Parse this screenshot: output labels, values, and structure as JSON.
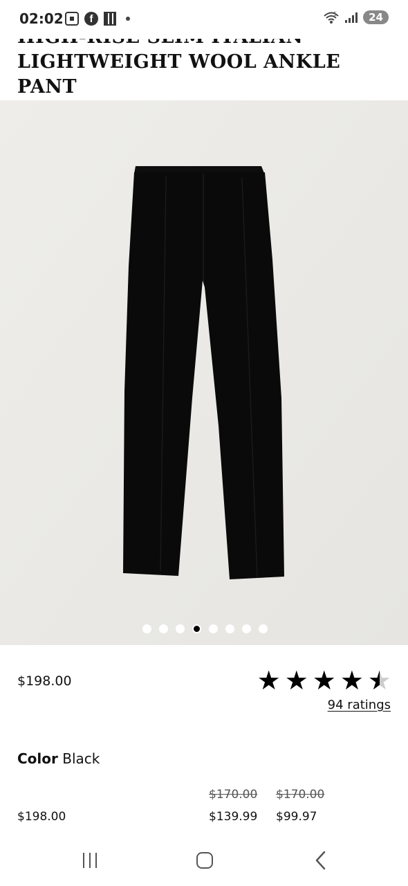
{
  "status_bar": {
    "time": "02:02",
    "battery": "24",
    "network": "5"
  },
  "product": {
    "title": "High-Rise Slim Italian Lightweight Wool Ankle Pant",
    "price": "$198.00",
    "rating": {
      "value": 4.5,
      "max": 5,
      "ratings_label": "94 ratings"
    },
    "color": {
      "label": "Color",
      "value": "Black"
    },
    "image": {
      "slide_count": 8,
      "active_slide": 4,
      "background": "#ebeae6"
    },
    "price_options": [
      {
        "original": "",
        "current": "$198.00"
      },
      {
        "original": "$170.00",
        "current": "$139.99"
      },
      {
        "original": "$170.00",
        "current": "$99.97"
      }
    ]
  },
  "icons": {
    "status_left": [
      "screenshot-icon",
      "facebook-icon",
      "qr-icon",
      "dot-icon"
    ],
    "status_right": [
      "wifi-icon",
      "signal-icon",
      "battery-icon"
    ],
    "nav": [
      "recents-icon",
      "home-icon",
      "back-icon"
    ]
  },
  "colors": {
    "text": "#111111",
    "image_bg": "#ebeae6",
    "star": "#000000",
    "star_empty": "#cccccc"
  }
}
